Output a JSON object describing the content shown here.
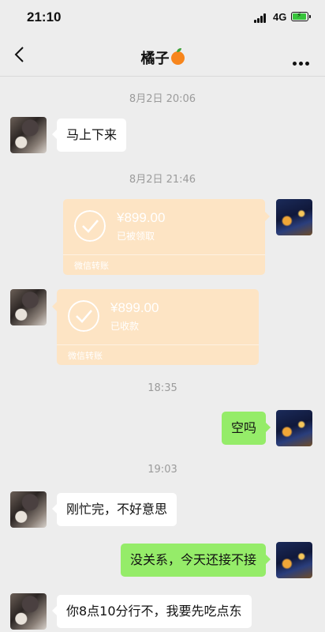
{
  "status_bar": {
    "time": "21:10",
    "network": "4G",
    "battery_icon": "battery-charging-icon",
    "signal_icon": "signal-icon"
  },
  "header": {
    "title": "橘子",
    "title_emoji_icon": "orange-icon",
    "back_icon": "back-chevron-icon",
    "more_icon": "more-icon"
  },
  "colors": {
    "background": "#ededed",
    "self_bubble": "#95ec69",
    "peer_bubble": "#ffffff",
    "transfer_card": "#fde4c4"
  },
  "messages": [
    {
      "type": "time",
      "text": "8月2日 20:06"
    },
    {
      "type": "text",
      "from": "peer",
      "text": "马上下来"
    },
    {
      "type": "time",
      "text": "8月2日 21:46"
    },
    {
      "type": "transfer",
      "from": "self",
      "amount": "¥899.00",
      "status": "已被领取",
      "label": "微信转账"
    },
    {
      "type": "transfer",
      "from": "peer",
      "amount": "¥899.00",
      "status": "已收款",
      "label": "微信转账"
    },
    {
      "type": "time",
      "text": "18:35"
    },
    {
      "type": "text",
      "from": "self",
      "text": "空吗"
    },
    {
      "type": "time",
      "text": "19:03"
    },
    {
      "type": "text",
      "from": "peer",
      "text": "刚忙完，不好意思"
    },
    {
      "type": "text",
      "from": "self",
      "text": "没关系，今天还接不接"
    },
    {
      "type": "text",
      "from": "peer",
      "text": "你8点10分行不，我要先吃点东"
    }
  ]
}
